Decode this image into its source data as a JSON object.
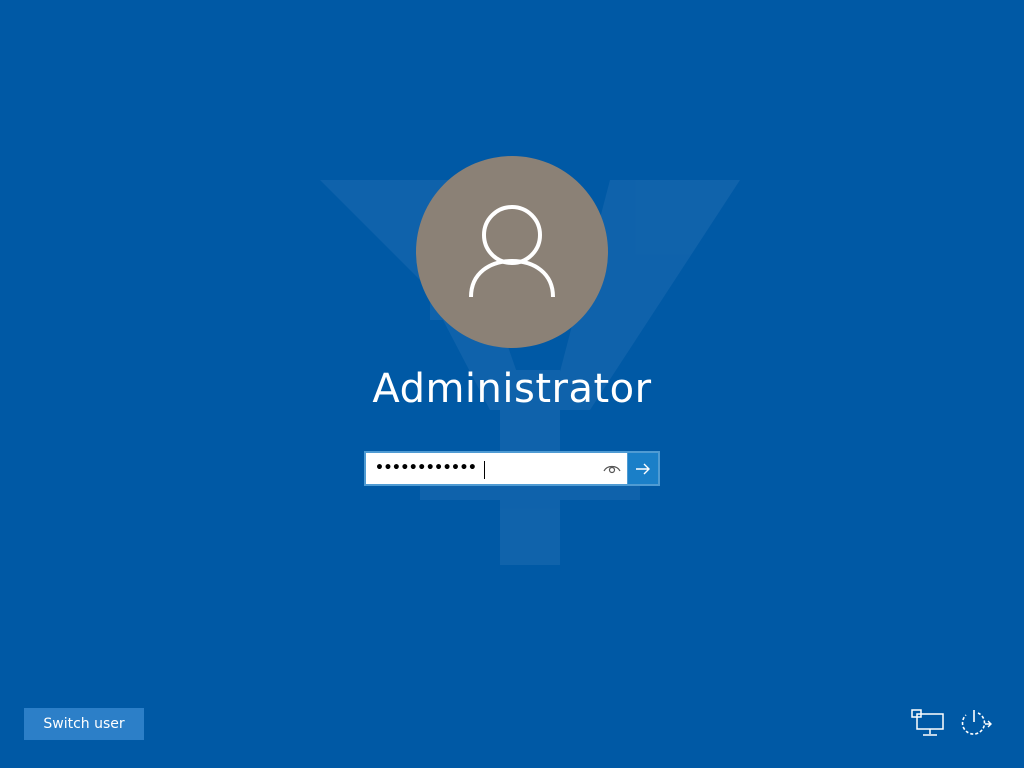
{
  "screen": {
    "background_color": "#0059a5",
    "accent_color": "#1a7fc8"
  },
  "user": {
    "name": "Administrator",
    "avatar_icon": "user-silhouette-icon"
  },
  "password": {
    "masked_value": "••••••••••••",
    "reveal_icon": "eye-icon",
    "submit_icon": "arrow-right-icon"
  },
  "switch_user": {
    "label": "Switch user"
  },
  "tray": {
    "network_icon": "network-icon",
    "power_icon": "power-icon"
  }
}
